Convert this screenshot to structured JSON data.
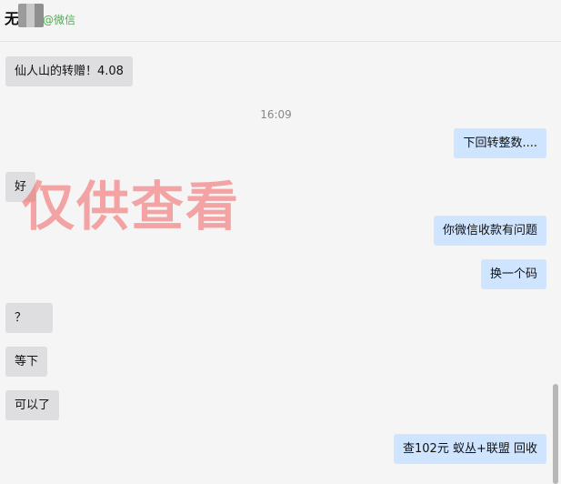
{
  "header": {
    "name": "无",
    "source": "@微信"
  },
  "chat": {
    "timestamp": "16:09",
    "watermark": "仅供查看",
    "messages": [
      {
        "dir": "in",
        "text": "仙人山的转赠！4.08"
      },
      {
        "dir": "out",
        "text": "下回转整数...."
      },
      {
        "dir": "in",
        "text": "好"
      },
      {
        "dir": "out",
        "text": "你微信收款有问题"
      },
      {
        "dir": "out",
        "text": "换一个码"
      },
      {
        "dir": "in",
        "text": "？"
      },
      {
        "dir": "in",
        "text": "等下"
      },
      {
        "dir": "in",
        "text": "可以了"
      },
      {
        "dir": "out",
        "text": "查102元 蚁丛+联盟 回收"
      }
    ]
  }
}
